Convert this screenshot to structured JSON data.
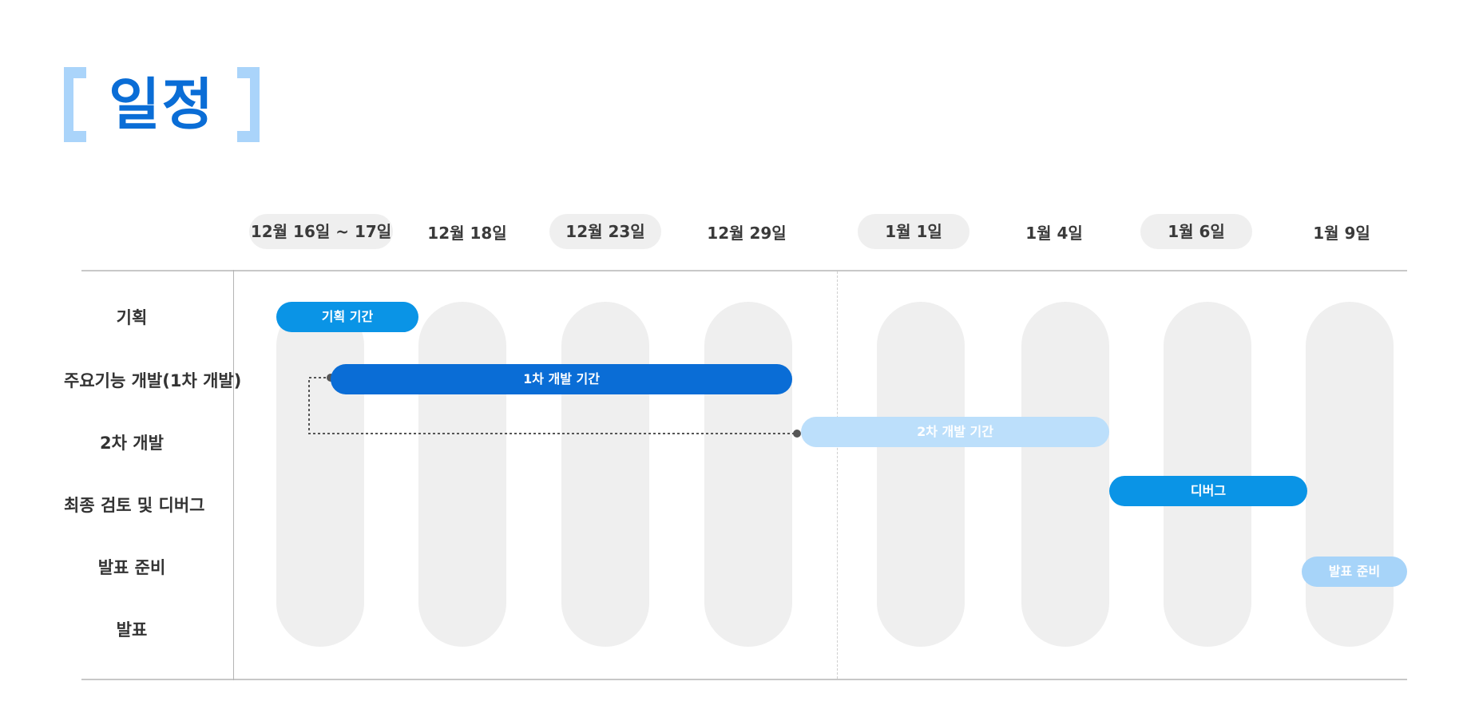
{
  "title": "일정",
  "dates": [
    "12월 16일 ~ 17일",
    "12월 18일",
    "12월 23일",
    "12월 29일",
    "1월 1일",
    "1월 4일",
    "1월 6일",
    "1월 9일"
  ],
  "rows": [
    "기획",
    "주요기능 개발(1차 개발)",
    "2차 개발",
    "최종 검토 및 디버그",
    "발표 준비",
    "발표"
  ],
  "bars": {
    "planning": "기획 기간",
    "dev1": "1차 개발 기간",
    "dev2": "2차 개발 기간",
    "debug": "디버그",
    "prep": "발표 준비"
  },
  "colors": {
    "title": "#0a6dd6",
    "bracket": "#aad4fa",
    "bar_primary": "#0a94e6",
    "bar_dark": "#0a6dd6",
    "bar_light": "#bcdffb",
    "column": "#efefef"
  }
}
